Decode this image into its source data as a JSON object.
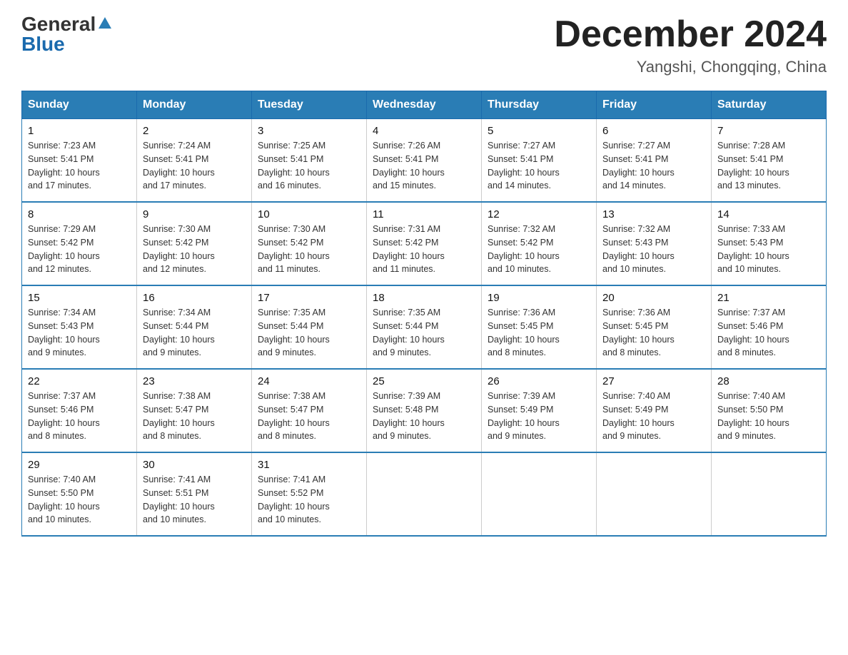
{
  "logo": {
    "general": "General",
    "blue": "Blue"
  },
  "title": "December 2024",
  "location": "Yangshi, Chongqing, China",
  "headers": [
    "Sunday",
    "Monday",
    "Tuesday",
    "Wednesday",
    "Thursday",
    "Friday",
    "Saturday"
  ],
  "weeks": [
    [
      {
        "day": "1",
        "sunrise": "7:23 AM",
        "sunset": "5:41 PM",
        "daylight": "10 hours and 17 minutes."
      },
      {
        "day": "2",
        "sunrise": "7:24 AM",
        "sunset": "5:41 PM",
        "daylight": "10 hours and 17 minutes."
      },
      {
        "day": "3",
        "sunrise": "7:25 AM",
        "sunset": "5:41 PM",
        "daylight": "10 hours and 16 minutes."
      },
      {
        "day": "4",
        "sunrise": "7:26 AM",
        "sunset": "5:41 PM",
        "daylight": "10 hours and 15 minutes."
      },
      {
        "day": "5",
        "sunrise": "7:27 AM",
        "sunset": "5:41 PM",
        "daylight": "10 hours and 14 minutes."
      },
      {
        "day": "6",
        "sunrise": "7:27 AM",
        "sunset": "5:41 PM",
        "daylight": "10 hours and 14 minutes."
      },
      {
        "day": "7",
        "sunrise": "7:28 AM",
        "sunset": "5:41 PM",
        "daylight": "10 hours and 13 minutes."
      }
    ],
    [
      {
        "day": "8",
        "sunrise": "7:29 AM",
        "sunset": "5:42 PM",
        "daylight": "10 hours and 12 minutes."
      },
      {
        "day": "9",
        "sunrise": "7:30 AM",
        "sunset": "5:42 PM",
        "daylight": "10 hours and 12 minutes."
      },
      {
        "day": "10",
        "sunrise": "7:30 AM",
        "sunset": "5:42 PM",
        "daylight": "10 hours and 11 minutes."
      },
      {
        "day": "11",
        "sunrise": "7:31 AM",
        "sunset": "5:42 PM",
        "daylight": "10 hours and 11 minutes."
      },
      {
        "day": "12",
        "sunrise": "7:32 AM",
        "sunset": "5:42 PM",
        "daylight": "10 hours and 10 minutes."
      },
      {
        "day": "13",
        "sunrise": "7:32 AM",
        "sunset": "5:43 PM",
        "daylight": "10 hours and 10 minutes."
      },
      {
        "day": "14",
        "sunrise": "7:33 AM",
        "sunset": "5:43 PM",
        "daylight": "10 hours and 10 minutes."
      }
    ],
    [
      {
        "day": "15",
        "sunrise": "7:34 AM",
        "sunset": "5:43 PM",
        "daylight": "10 hours and 9 minutes."
      },
      {
        "day": "16",
        "sunrise": "7:34 AM",
        "sunset": "5:44 PM",
        "daylight": "10 hours and 9 minutes."
      },
      {
        "day": "17",
        "sunrise": "7:35 AM",
        "sunset": "5:44 PM",
        "daylight": "10 hours and 9 minutes."
      },
      {
        "day": "18",
        "sunrise": "7:35 AM",
        "sunset": "5:44 PM",
        "daylight": "10 hours and 9 minutes."
      },
      {
        "day": "19",
        "sunrise": "7:36 AM",
        "sunset": "5:45 PM",
        "daylight": "10 hours and 8 minutes."
      },
      {
        "day": "20",
        "sunrise": "7:36 AM",
        "sunset": "5:45 PM",
        "daylight": "10 hours and 8 minutes."
      },
      {
        "day": "21",
        "sunrise": "7:37 AM",
        "sunset": "5:46 PM",
        "daylight": "10 hours and 8 minutes."
      }
    ],
    [
      {
        "day": "22",
        "sunrise": "7:37 AM",
        "sunset": "5:46 PM",
        "daylight": "10 hours and 8 minutes."
      },
      {
        "day": "23",
        "sunrise": "7:38 AM",
        "sunset": "5:47 PM",
        "daylight": "10 hours and 8 minutes."
      },
      {
        "day": "24",
        "sunrise": "7:38 AM",
        "sunset": "5:47 PM",
        "daylight": "10 hours and 8 minutes."
      },
      {
        "day": "25",
        "sunrise": "7:39 AM",
        "sunset": "5:48 PM",
        "daylight": "10 hours and 9 minutes."
      },
      {
        "day": "26",
        "sunrise": "7:39 AM",
        "sunset": "5:49 PM",
        "daylight": "10 hours and 9 minutes."
      },
      {
        "day": "27",
        "sunrise": "7:40 AM",
        "sunset": "5:49 PM",
        "daylight": "10 hours and 9 minutes."
      },
      {
        "day": "28",
        "sunrise": "7:40 AM",
        "sunset": "5:50 PM",
        "daylight": "10 hours and 9 minutes."
      }
    ],
    [
      {
        "day": "29",
        "sunrise": "7:40 AM",
        "sunset": "5:50 PM",
        "daylight": "10 hours and 10 minutes."
      },
      {
        "day": "30",
        "sunrise": "7:41 AM",
        "sunset": "5:51 PM",
        "daylight": "10 hours and 10 minutes."
      },
      {
        "day": "31",
        "sunrise": "7:41 AM",
        "sunset": "5:52 PM",
        "daylight": "10 hours and 10 minutes."
      },
      null,
      null,
      null,
      null
    ]
  ],
  "labels": {
    "sunrise": "Sunrise:",
    "sunset": "Sunset:",
    "daylight": "Daylight:"
  }
}
